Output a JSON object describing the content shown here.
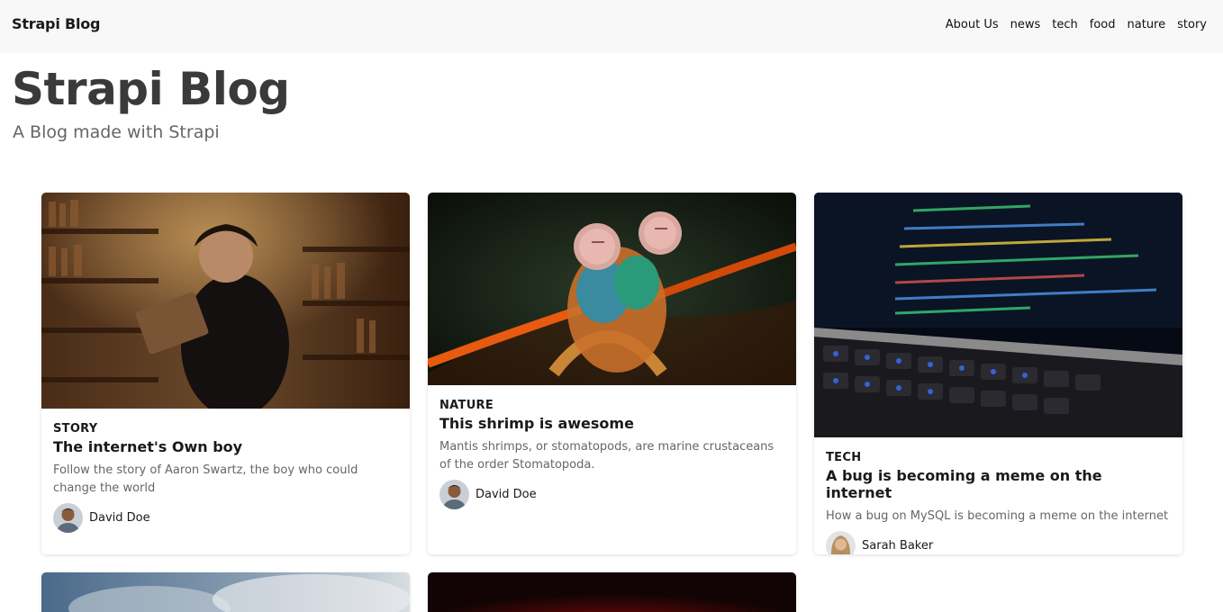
{
  "nav": {
    "brand": "Strapi Blog",
    "links": [
      "About Us",
      "news",
      "tech",
      "food",
      "nature",
      "story"
    ]
  },
  "hero": {
    "title": "Strapi Blog",
    "subtitle": "A Blog made with Strapi"
  },
  "articles": [
    {
      "category": "STORY",
      "title": "The internet's Own boy",
      "description": "Follow the story of Aaron Swartz, the boy who could change the world",
      "author": "David Doe"
    },
    {
      "category": "NATURE",
      "title": "This shrimp is awesome",
      "description": "Mantis shrimps, or stomatopods, are marine crustaceans of the order Stomatopoda.",
      "author": "David Doe"
    },
    {
      "category": "TECH",
      "title": "A bug is becoming a meme on the internet",
      "description": "How a bug on MySQL is becoming a meme on the internet",
      "author": "Sarah Baker"
    }
  ],
  "colors": {
    "navbar_bg": "#f8f8f8",
    "hero_title": "#3a3a3a",
    "muted_text": "#666666"
  }
}
